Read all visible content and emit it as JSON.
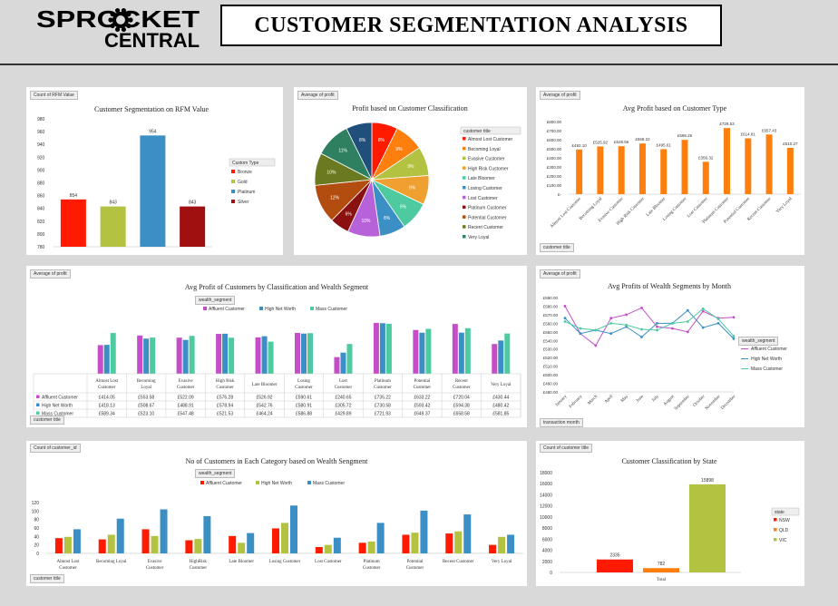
{
  "header": {
    "logo_top": "SPROCKET",
    "logo_bottom": "CENTRAL",
    "title": "CUSTOMER SEGMENTATION ANALYSIS"
  },
  "panels": {
    "p1": {
      "tag": "Count of RFM Value"
    },
    "p2": {
      "tag": "Average of profit",
      "filter": "customer title"
    },
    "p3": {
      "tag": "Average of profit",
      "filter": "customer title"
    },
    "p4": {
      "tag": "Average of profit",
      "filter": "customer title",
      "legend_filter": "wealth_segment"
    },
    "p5": {
      "tag": "Average of profit",
      "filter": "transaction month",
      "legend_filter": "wealth_segment"
    },
    "p6": {
      "tag": "Count of customer_id",
      "filter": "customer title",
      "legend_filter": "wealth_segment"
    },
    "p7": {
      "tag": "Count of customer title",
      "legend_filter": "state"
    }
  },
  "chart_data": [
    {
      "type": "bar",
      "title": "Customer Segmentation on RFM Value",
      "legend_title": "Custom Type",
      "categories": [
        "Bronze",
        "Gold",
        "Platinum",
        "Silver"
      ],
      "values": [
        854,
        843,
        954,
        843
      ],
      "colors": [
        "#ff1a00",
        "#b3c240",
        "#3b8fc5",
        "#a01010"
      ],
      "ylim": [
        780,
        980
      ],
      "yticks": [
        780,
        800,
        820,
        840,
        860,
        880,
        900,
        920,
        940,
        960,
        980
      ],
      "legend_position": "right"
    },
    {
      "type": "pie",
      "title": "Profit based on Customer Classification",
      "legend_title": "customer title",
      "labels": [
        "Almost Lost Customer",
        "Becoming Loyal",
        "Evasive Customer",
        "High Risk Customer",
        "Late Bloomer",
        "Losing Customer",
        "Lost Customer",
        "Platinum Customer",
        "Potential Customer",
        "Recent Customer",
        "Very Loyal"
      ],
      "values": [
        8,
        9,
        9,
        9,
        9,
        8,
        10,
        6,
        12,
        10,
        11,
        8
      ],
      "slice_labels": [
        "8%",
        "9%",
        "9%",
        "9%",
        "9%",
        "8%",
        "10%",
        "6%",
        "12%",
        "10%",
        "11%",
        "8%"
      ],
      "colors": [
        "#ff1a00",
        "#ff7f0e",
        "#b3c240",
        "#f0a030",
        "#4dcaa0",
        "#3b8fc5",
        "#b862d9",
        "#8b1010",
        "#b34d0f",
        "#6b7a20",
        "#2e8060",
        "#1f4f7a"
      ],
      "legend_colors": [
        "#ff1a00",
        "#ff7f0e",
        "#b3c240",
        "#f0a030",
        "#4dcaa0",
        "#3b8fc5",
        "#b862d9",
        "#8b1010",
        "#b34d0f",
        "#6b7a20",
        "#2e8060"
      ],
      "legend_position": "right"
    },
    {
      "type": "bar",
      "title": "Avg Profit based on Customer Type",
      "categories": [
        "Almost Lost Customer",
        "Becoming Loyal",
        "Evasive Customer",
        "High Risk Customer",
        "Late Bloomer",
        "Losing Customer",
        "Lost Customer",
        "Platinum Customer",
        "Potential Customer",
        "Recent Customer",
        "Very Loyal"
      ],
      "values": [
        492.1,
        525.92,
        528.56,
        558.22,
        495.61,
        598.26,
        356.32,
        728.53,
        614.81,
        657.43,
        510.27
      ],
      "labels": [
        "£492.10",
        "£525.92",
        "£528.56",
        "£558.22",
        "£495.61",
        "£598.26",
        "£356.32",
        "£728.53",
        "£614.81",
        "£657.43",
        "£510.27"
      ],
      "color": "#ff7f0e",
      "ylim": [
        0,
        800
      ],
      "yticks": [
        "£-",
        "£100.00",
        "£200.00",
        "£300.00",
        "£400.00",
        "£500.00",
        "£600.00",
        "£700.00",
        "£800.00"
      ]
    },
    {
      "type": "bar",
      "title": "Avg Profit of Customers by Classification and Wealth Segment",
      "categories": [
        "Almost Lost Customer",
        "Becoming Loyal",
        "Evasive Customer",
        "High Risk Customer",
        "Late Bloomer",
        "Losing Customer",
        "Lost Customer",
        "Platinum Customer",
        "Potential Customer",
        "Recent Customer",
        "Very Loyal"
      ],
      "series": [
        {
          "name": "Affluent Customer",
          "color": "#c54ec8",
          "values": [
            414.05,
            553.58,
            522.09,
            576.28,
            526.92,
            590.61,
            240.65,
            735.22,
            633.22,
            720.04,
            430.44
          ],
          "labels": [
            "£414.05",
            "£553.58",
            "£522.09",
            "£576.28",
            "£526.92",
            "£590.61",
            "£240.65",
            "£735.22",
            "£633.22",
            "£720.04",
            "£430.44"
          ]
        },
        {
          "name": "High Net Worth",
          "color": "#3b8fc5",
          "values": [
            418.13,
            508.67,
            488.91,
            578.94,
            542.76,
            580.91,
            305.72,
            730.58,
            593.42,
            594.38,
            480.42
          ],
          "labels": [
            "£418.13",
            "£508.67",
            "£488.91",
            "£578.94",
            "£542.76",
            "£580.91",
            "£305.72",
            "£730.58",
            "£593.42",
            "£594.38",
            "£480.42"
          ]
        },
        {
          "name": "Mass Customer",
          "color": "#4dcaa0",
          "values": [
            589.34,
            523.1,
            547.48,
            521.53,
            464.24,
            586.88,
            429.89,
            721.93,
            649.37,
            658.58,
            581.85
          ],
          "labels": [
            "£589.34",
            "£523.10",
            "£547.48",
            "£521.53",
            "£464.24",
            "£586.88",
            "£429.89",
            "£721.93",
            "£649.37",
            "£658.58",
            "£581.85"
          ]
        }
      ],
      "legend_position": "top"
    },
    {
      "type": "line",
      "title": "Avg Profits of Wealth Segments by Month",
      "x": [
        "January",
        "February",
        "March",
        "April",
        "May",
        "June",
        "July",
        "August",
        "September",
        "October",
        "November",
        "December"
      ],
      "series": [
        {
          "name": "Affluent Customer",
          "color": "#c54ec8",
          "values": [
            580,
            548,
            534,
            566,
            570,
            578,
            556,
            554,
            550,
            574,
            566,
            567
          ]
        },
        {
          "name": "High Net Worth",
          "color": "#3b8fc5",
          "values": [
            566,
            548,
            552,
            548,
            556,
            544,
            560,
            560,
            575,
            555,
            560,
            542
          ]
        },
        {
          "name": "Mass Customer",
          "color": "#4dcaa0",
          "values": [
            562,
            554,
            552,
            560,
            558,
            553,
            552,
            560,
            562,
            577,
            565,
            545
          ]
        }
      ],
      "ylim": [
        480,
        590
      ],
      "yticks": [
        "£480.00",
        "£490.00",
        "£500.00",
        "£510.00",
        "£520.00",
        "£530.00",
        "£540.00",
        "£550.00",
        "£560.00",
        "£570.00",
        "£580.00",
        "£590.00"
      ],
      "legend_position": "right"
    },
    {
      "type": "bar",
      "title": "No of Customers in Each Category based on Wealth Sengment",
      "categories": [
        "Almost Lost Customer",
        "Becoming Loyal",
        "Evasive Customer",
        "HighRisk Customer",
        "Late Bloomer",
        "Losing Customer",
        "Lost Customer",
        "Platinum Customer",
        "Potential Customer",
        "Recent Customer",
        "Very Loyal"
      ],
      "series": [
        {
          "name": "Affluent Customer",
          "color": "#ff1a00",
          "values": [
            36,
            33,
            57,
            31,
            41,
            59,
            15,
            25,
            44,
            47,
            20
          ]
        },
        {
          "name": "High Net Worth",
          "color": "#b3c240",
          "values": [
            39,
            44,
            41,
            34,
            25,
            72,
            20,
            28,
            49,
            52,
            39
          ]
        },
        {
          "name": "Mass Customer",
          "color": "#3b8fc5",
          "values": [
            57,
            82,
            104,
            88,
            48,
            113,
            37,
            72,
            101,
            92,
            44
          ]
        }
      ],
      "ylim": [
        0,
        120
      ],
      "yticks": [
        0,
        20,
        40,
        60,
        80,
        100,
        120
      ],
      "legend_position": "top"
    },
    {
      "type": "bar",
      "title": "Customer Classification by State",
      "categories": [
        "Total"
      ],
      "series": [
        {
          "name": "NSW",
          "color": "#ff1a00",
          "values": [
            2335
          ]
        },
        {
          "name": "QLD",
          "color": "#ff7f0e",
          "values": [
            782
          ]
        },
        {
          "name": "VIC",
          "color": "#b3c240",
          "values": [
            15898
          ]
        }
      ],
      "labels": [
        "2335",
        "782",
        "15898"
      ],
      "ylim": [
        0,
        18000
      ],
      "yticks": [
        0,
        2000,
        4000,
        6000,
        8000,
        10000,
        12000,
        14000,
        16000,
        18000
      ],
      "legend_title": "state",
      "legend_position": "right"
    }
  ]
}
